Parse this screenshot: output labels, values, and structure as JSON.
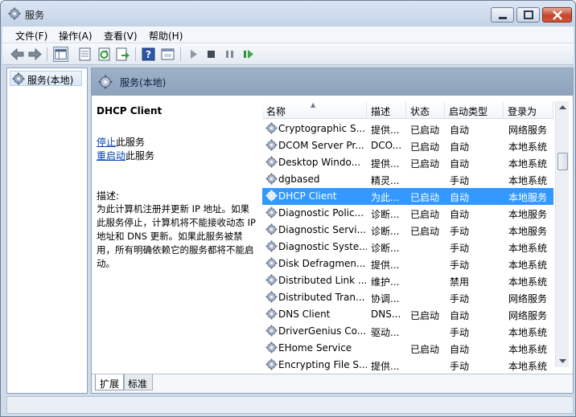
{
  "window": {
    "title": "服务"
  },
  "menu": {
    "items": [
      "文件(F)",
      "操作(A)",
      "查看(V)",
      "帮助(H)"
    ]
  },
  "toolbar": {
    "icons": [
      "back-arrow-icon",
      "forward-arrow-icon",
      "show-tree-icon",
      "properties-icon",
      "refresh-icon",
      "export-icon",
      "help-icon",
      "console-icon",
      "start-service-icon",
      "stop-service-icon",
      "pause-service-icon",
      "restart-service-icon"
    ]
  },
  "tree": {
    "root_label": "服务(本地)"
  },
  "main": {
    "header_label": "服务(本地)"
  },
  "detail": {
    "service_name": "DHCP Client",
    "stop_link": "停止",
    "stop_suffix": "此服务",
    "restart_link": "重启动",
    "restart_suffix": "此服务",
    "desc_label": "描述:",
    "desc_text": "为此计算机注册并更新 IP 地址。如果此服务停止，计算机将不能接收动态 IP 地址和 DNS 更新。如果此服务被禁用，所有明确依赖它的服务都将不能启动。"
  },
  "list": {
    "columns": [
      "名称",
      "描述",
      "状态",
      "启动类型",
      "登录为"
    ],
    "selected_index": 4,
    "rows": [
      [
        "Cryptographic S...",
        "提供...",
        "已启动",
        "自动",
        "网络服务"
      ],
      [
        "DCOM Server Pr...",
        "DCO...",
        "已启动",
        "自动",
        "本地系统"
      ],
      [
        "Desktop Windo...",
        "提供...",
        "已启动",
        "自动",
        "本地系统"
      ],
      [
        "dgbased",
        "精灵...",
        "",
        "手动",
        "本地系统"
      ],
      [
        "DHCP Client",
        "为此...",
        "已启动",
        "自动",
        "本地服务"
      ],
      [
        "Diagnostic Polic...",
        "诊断...",
        "已启动",
        "自动",
        "本地服务"
      ],
      [
        "Diagnostic Servi...",
        "诊断...",
        "已启动",
        "手动",
        "本地服务"
      ],
      [
        "Diagnostic Syste...",
        "诊断...",
        "",
        "手动",
        "本地系统"
      ],
      [
        "Disk Defragmen...",
        "提供...",
        "",
        "手动",
        "本地系统"
      ],
      [
        "Distributed Link ...",
        "维护...",
        "",
        "禁用",
        "本地系统"
      ],
      [
        "Distributed Tran...",
        "协调...",
        "",
        "手动",
        "网络服务"
      ],
      [
        "DNS Client",
        "DNS...",
        "已启动",
        "自动",
        "网络服务"
      ],
      [
        "DriverGenius Co...",
        "驱动...",
        "",
        "手动",
        "本地系统"
      ],
      [
        "EHome Service",
        "",
        "已启动",
        "自动",
        "本地系统"
      ],
      [
        "Encrypting File S...",
        "提供...",
        "",
        "手动",
        "本地系统"
      ]
    ]
  },
  "tabs": {
    "items": [
      "扩展",
      "标准"
    ],
    "active": 0
  }
}
